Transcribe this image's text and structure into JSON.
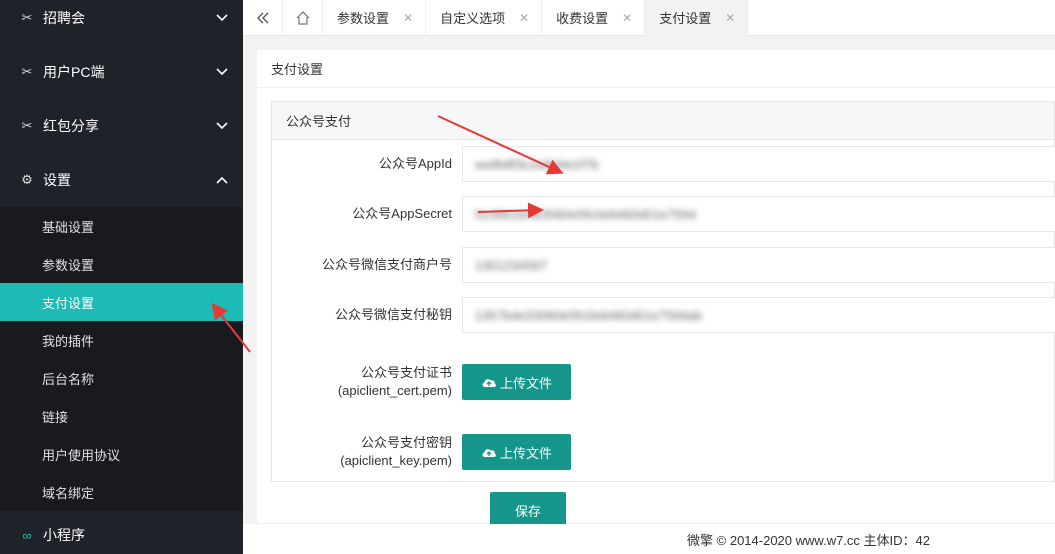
{
  "sidebar": {
    "groups": [
      {
        "label": "招聘会",
        "icon": "puzzle-icon",
        "expanded": false
      },
      {
        "label": "用户PC端",
        "icon": "puzzle-icon",
        "expanded": false
      },
      {
        "label": "红包分享",
        "icon": "puzzle-icon",
        "expanded": false
      },
      {
        "label": "设置",
        "icon": "gear-icon",
        "expanded": true
      }
    ],
    "settings_items": [
      "基础设置",
      "参数设置",
      "支付设置",
      "我的插件",
      "后台名称",
      "链接",
      "用户使用协议",
      "域名绑定"
    ],
    "active_item": "支付设置",
    "bottom_group": {
      "label": "小程序",
      "icon": "link-icon"
    }
  },
  "tabs": [
    {
      "label": "参数设置",
      "active": false
    },
    {
      "label": "自定义选项",
      "active": false
    },
    {
      "label": "收费设置",
      "active": false
    },
    {
      "label": "支付设置",
      "active": true
    }
  ],
  "page": {
    "title": "支付设置",
    "panel_title": "公众号支付",
    "fields": [
      {
        "label": "公众号AppId",
        "value": "wx8b8f3c2a9d4e1f7b"
      },
      {
        "label": "公众号AppSecret",
        "value": "f1c99ccb4e3060e5fc0e6460d01e7594"
      },
      {
        "label": "公众号微信支付商户号",
        "value": "1301234567"
      },
      {
        "label": "公众号微信支付秘钥",
        "value": "1357b4e33060e5fc0e6460d01e7594ab"
      }
    ],
    "uploads": [
      {
        "label": "公众号支付证书",
        "sublabel": "(apiclient_cert.pem)",
        "button": "上传文件"
      },
      {
        "label": "公众号支付密钥",
        "sublabel": "(apiclient_key.pem)",
        "button": "上传文件"
      }
    ],
    "save_label": "保存"
  },
  "footer": {
    "text": "微擎 © 2014-2020 www.w7.cc 主体ID：42"
  },
  "colors": {
    "sidebar_bg": "#20222a",
    "active": "#1cbbb4",
    "button": "#16968a",
    "annotation": "#e53935"
  }
}
